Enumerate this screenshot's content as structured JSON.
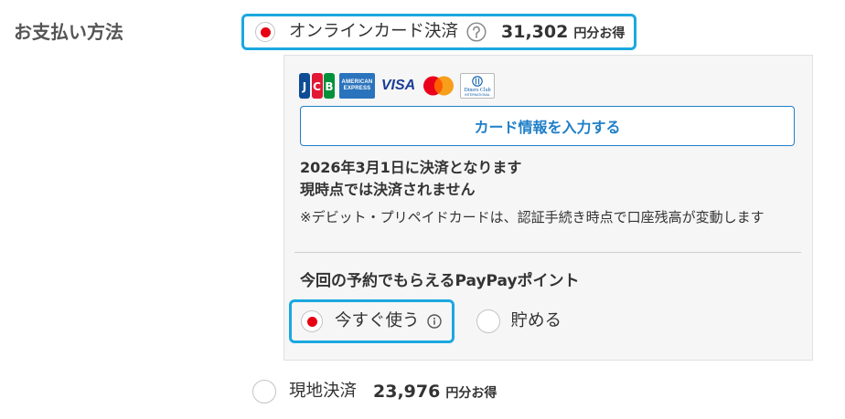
{
  "colors": {
    "highlight": "#1ba8e0",
    "radio-dot": "#e60012",
    "accent": "#1f7fc8",
    "panel-bg": "#f6f6f6",
    "panel-border": "#e1e1e1",
    "text": "#333333",
    "label": "#555555"
  },
  "section_label": "お支払い方法",
  "payment_options": {
    "online_card": {
      "label": "オンラインカード決済",
      "help_icon": "question-circle-icon",
      "savings_amount": "31,302",
      "savings_unit": "円分お得",
      "selected": true
    },
    "onsite": {
      "label": "現地決済",
      "savings_amount": "23,976",
      "savings_unit": "円分お得",
      "selected": false
    }
  },
  "card_panel": {
    "card_brands": [
      {
        "icon": "jcb-logo-icon",
        "letters": [
          "J",
          "C",
          "B"
        ]
      },
      {
        "icon": "amex-logo-icon",
        "lines": [
          "AMERICAN",
          "EXPRESS"
        ]
      },
      {
        "icon": "visa-logo-icon",
        "text": "VISA"
      },
      {
        "icon": "mastercard-logo-icon"
      },
      {
        "icon": "diners-club-logo-icon",
        "lines": [
          "Diners Club",
          "INTERNATIONAL"
        ]
      }
    ],
    "enter_card_button": "カード情報を入力する",
    "charge_date_note": "2026年3月1日に決済となります",
    "not_charged_note": "現時点では決済されません",
    "debit_note": "※デビット・プリペイドカードは、認証手続き時点で口座残高が変動します",
    "points": {
      "heading": "今回の予約でもらえるPayPayポイント",
      "options": [
        {
          "label": "今すぐ使う",
          "info_icon": "info-circle-icon",
          "selected": true
        },
        {
          "label": "貯める",
          "selected": false
        }
      ]
    }
  }
}
